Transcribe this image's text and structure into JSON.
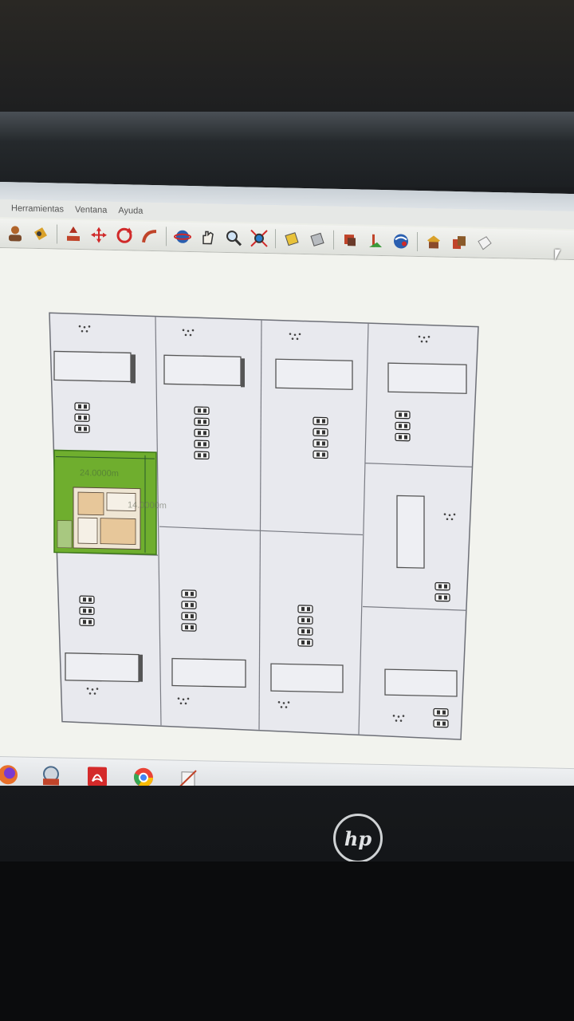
{
  "menu": {
    "items": [
      {
        "label": "Herramientas"
      },
      {
        "label": "Ventana"
      },
      {
        "label": "Ayuda"
      }
    ]
  },
  "toolbar": {
    "icons": [
      "user-icon",
      "paint-bucket-icon",
      "push-pull-icon",
      "move-icon",
      "rotate-icon",
      "follow-me-icon",
      "orbit-icon",
      "pan-icon",
      "zoom-icon",
      "zoom-extents-icon",
      "section-plane-icon",
      "section-display-icon",
      "get-models-icon",
      "share-model-icon",
      "geolocation-icon",
      "components-icon",
      "extension-warehouse-icon",
      "layout-icon"
    ]
  },
  "drawing": {
    "dimension_width": "24.0000m",
    "dimension_height": "14.0000m",
    "lot_colors": {
      "fill": "#e8e9ee",
      "line": "#6e7078",
      "highlight": "#6fae2e"
    }
  },
  "taskbar": {
    "apps": [
      "firefox-icon",
      "sketchup-icon",
      "acrobat-icon",
      "chrome-icon",
      "notepad-icon"
    ]
  },
  "brand": {
    "logo": "hp"
  }
}
